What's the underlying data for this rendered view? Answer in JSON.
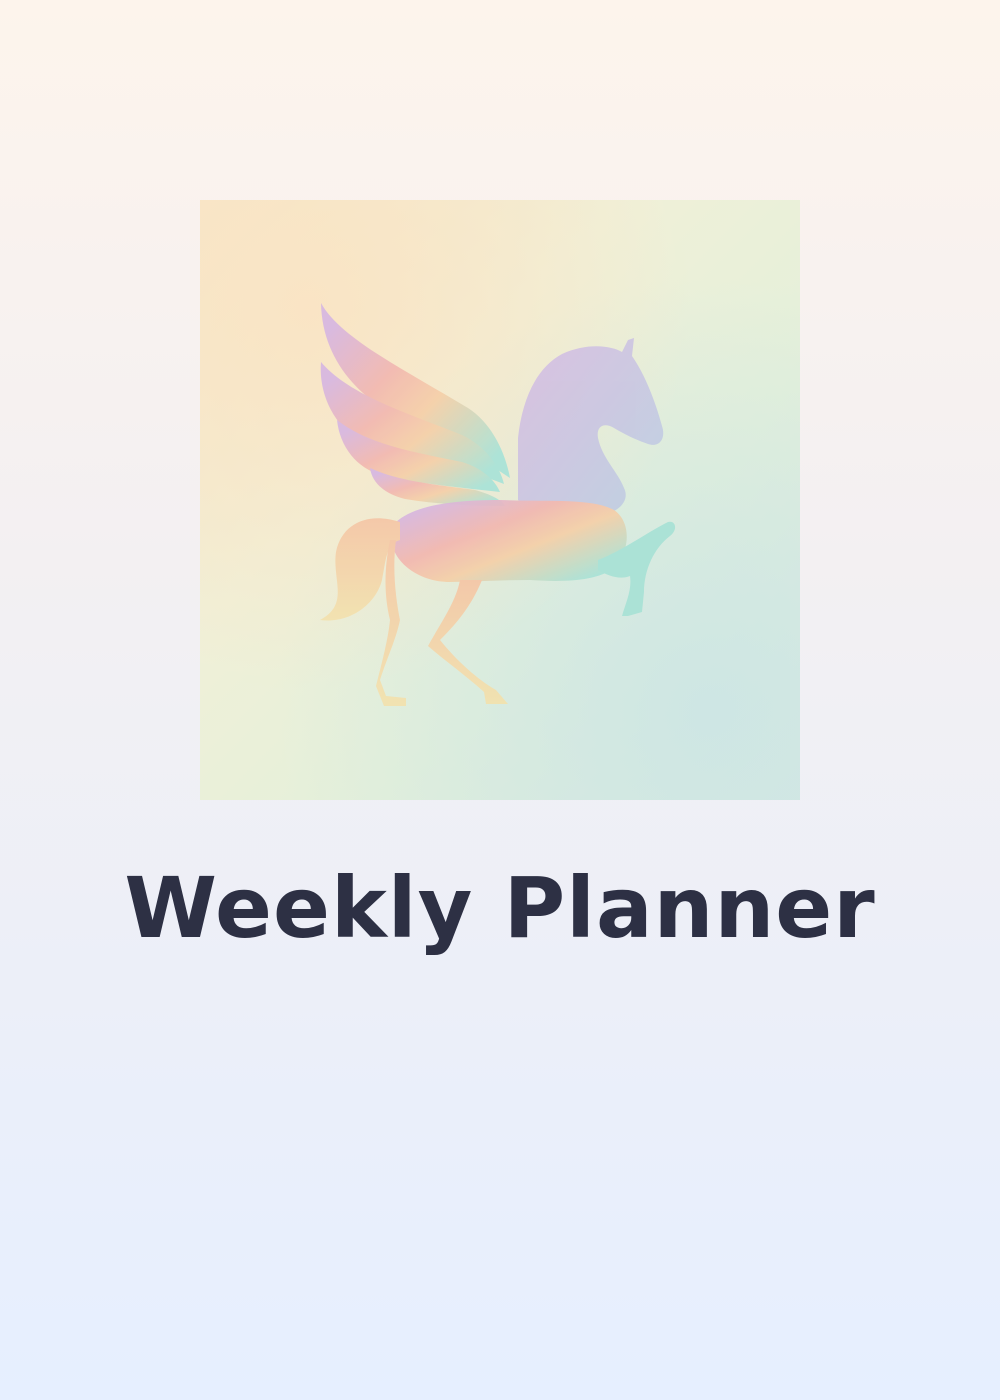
{
  "cover": {
    "title": "Weekly Planner",
    "illustration": {
      "icon": "winged-horse-pegasus-icon",
      "palette": [
        "#d9b8e4",
        "#f4b9a8",
        "#f6d6a4",
        "#a6e2d6",
        "#c4d0e6"
      ]
    }
  },
  "colors": {
    "title_text": "#2d3044",
    "page_top": "#fdf4ec",
    "page_bottom": "#e6efff"
  }
}
